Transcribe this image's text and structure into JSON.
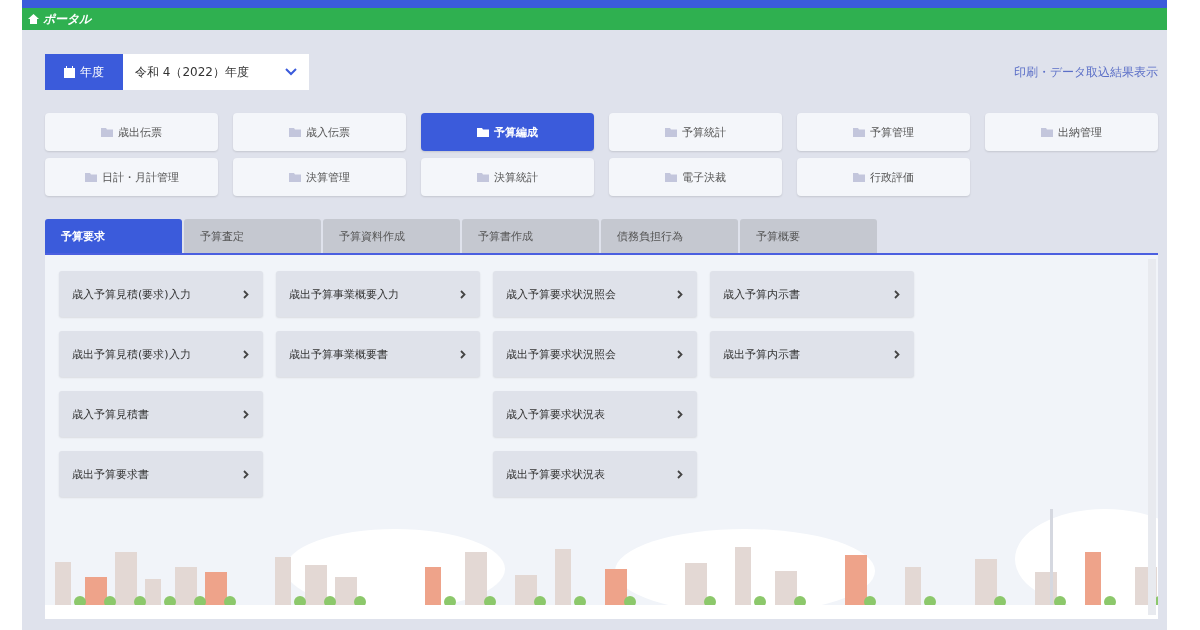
{
  "breadcrumb": "ポータル",
  "year": {
    "label": "年度",
    "value": "令和 4（2022）年度"
  },
  "result_link": "印刷・データ取込結果表示",
  "modules": [
    {
      "label": "歳出伝票",
      "selected": false
    },
    {
      "label": "歳入伝票",
      "selected": false
    },
    {
      "label": "予算編成",
      "selected": true
    },
    {
      "label": "予算統計",
      "selected": false
    },
    {
      "label": "予算管理",
      "selected": false
    },
    {
      "label": "出納管理",
      "selected": false
    },
    {
      "label": "日計・月計管理",
      "selected": false
    },
    {
      "label": "決算管理",
      "selected": false
    },
    {
      "label": "決算統計",
      "selected": false
    },
    {
      "label": "電子決裁",
      "selected": false
    },
    {
      "label": "行政評価",
      "selected": false
    }
  ],
  "tabs": [
    {
      "label": "予算要求",
      "selected": true
    },
    {
      "label": "予算査定",
      "selected": false
    },
    {
      "label": "予算資料作成",
      "selected": false
    },
    {
      "label": "予算書作成",
      "selected": false
    },
    {
      "label": "債務負担行為",
      "selected": false
    },
    {
      "label": "予算概要",
      "selected": false
    }
  ],
  "menu_columns": [
    [
      "歳入予算見積(要求)入力",
      "歳出予算見積(要求)入力",
      "歳入予算見積書",
      "歳出予算要求書"
    ],
    [
      "歳出予算事業概要入力",
      "歳出予算事業概要書"
    ],
    [
      "歳入予算要求状況照会",
      "歳出予算要求状況照会",
      "歳入予算要求状況表",
      "歳出予算要求状況表"
    ],
    [
      "歳入予算内示書",
      "歳出予算内示書"
    ]
  ]
}
